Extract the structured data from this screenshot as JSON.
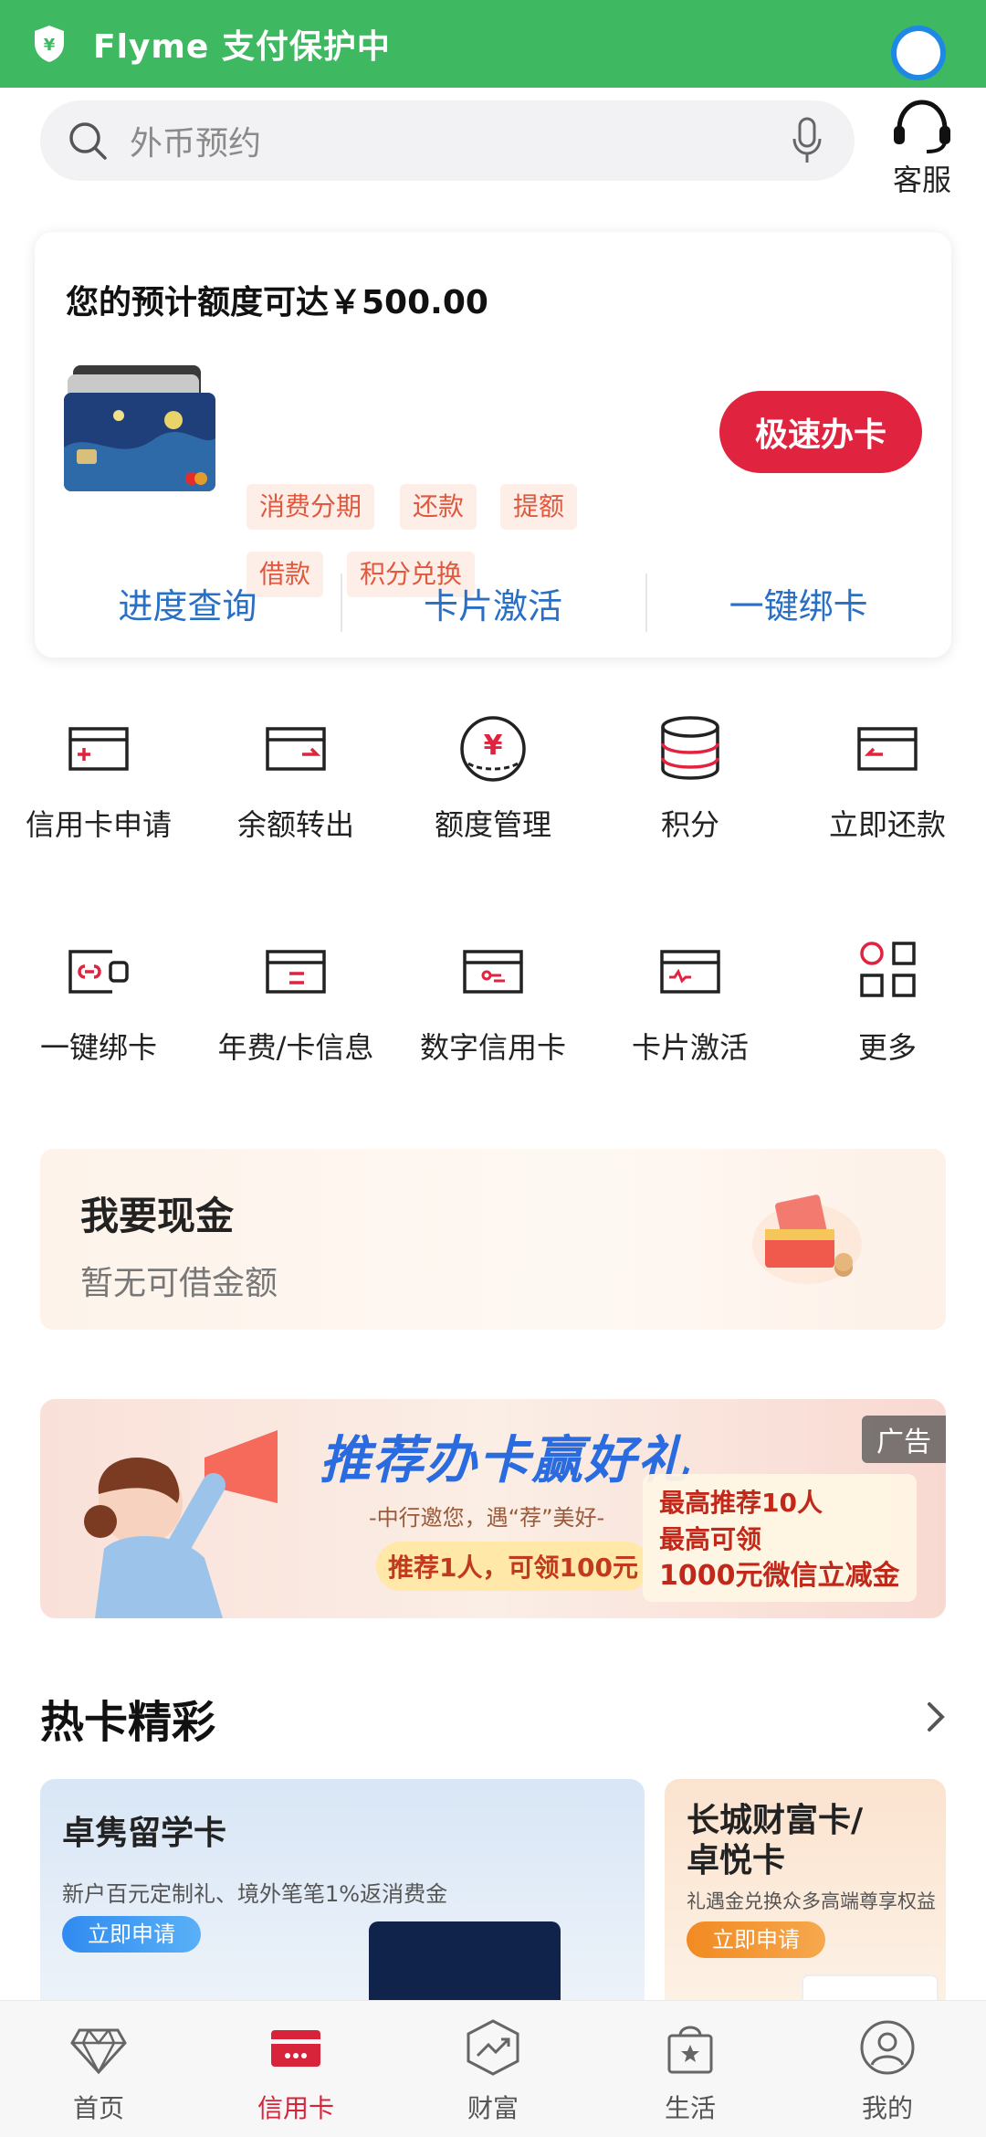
{
  "status": {
    "text": "Flyme 支付保护中",
    "icon": "shield-yen-icon"
  },
  "search": {
    "placeholder": "外币预约",
    "service_label": "客服"
  },
  "card_panel": {
    "limit_title": "您的预计额度可达￥500.00",
    "tags": [
      "消费分期",
      "还款",
      "提额",
      "借款",
      "积分兑换"
    ],
    "apply_label": "极速办卡",
    "links": [
      "进度查询",
      "卡片激活",
      "一键绑卡"
    ]
  },
  "grid": {
    "row1": [
      {
        "label": "信用卡申请",
        "icon": "card-plus-icon"
      },
      {
        "label": "余额转出",
        "icon": "card-transfer-out-icon"
      },
      {
        "label": "额度管理",
        "icon": "yen-circle-icon"
      },
      {
        "label": "积分",
        "icon": "database-stack-icon"
      },
      {
        "label": "立即还款",
        "icon": "card-repay-icon"
      }
    ],
    "row2": [
      {
        "label": "一键绑卡",
        "icon": "card-link-icon"
      },
      {
        "label": "年费/卡信息",
        "icon": "card-info-icon"
      },
      {
        "label": "数字信用卡",
        "icon": "digital-card-icon"
      },
      {
        "label": "卡片激活",
        "icon": "card-activate-icon"
      },
      {
        "label": "更多",
        "icon": "grid-more-icon"
      }
    ]
  },
  "cash": {
    "title": "我要现金",
    "subtitle": "暂无可借金额"
  },
  "ad": {
    "headline": "推荐办卡赢好礼",
    "badge": "广告",
    "invite": "-中行邀您，遇“荐”美好-",
    "ribbon": "推荐1人，可领100元",
    "line1": "最高推荐10人",
    "line2": "最高可领",
    "line3": "1000元微信立减金"
  },
  "hot": {
    "title": "热卡精彩",
    "cards": [
      {
        "title": "卓隽留学卡",
        "subtitle": "新户百元定制礼、境外笔笔1%返消费金",
        "button": "立即申请"
      },
      {
        "title": "长城财富卡/\n卓悦卡",
        "title_line1": "长城财富卡/",
        "title_line2": "卓悦卡",
        "subtitle": "礼遇金兑换众多高端尊享权益",
        "button": "立即申请"
      }
    ]
  },
  "tabs": [
    {
      "label": "首页",
      "icon": "diamond-icon"
    },
    {
      "label": "信用卡",
      "icon": "credit-card-icon",
      "active": true
    },
    {
      "label": "财富",
      "icon": "trend-chart-icon"
    },
    {
      "label": "生活",
      "icon": "shopping-bag-star-icon"
    },
    {
      "label": "我的",
      "icon": "user-circle-icon"
    }
  ],
  "colors": {
    "accent_red": "#e0243f",
    "link_blue": "#2a6fc6",
    "status_green": "#3fb961"
  }
}
